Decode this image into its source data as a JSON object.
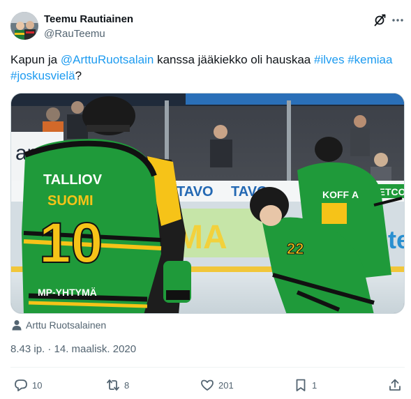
{
  "author": {
    "name": "Teemu Rautiainen",
    "handle": "@RauTeemu"
  },
  "tweet": {
    "text_parts": [
      {
        "text": "Kapun ja ",
        "type": "plain"
      },
      {
        "text": "@ArttuRuotsalain",
        "type": "link"
      },
      {
        "text": " kanssa jääkiekko oli hauskaa ",
        "type": "plain"
      },
      {
        "text": "#ilves",
        "type": "link"
      },
      {
        "text": " ",
        "type": "plain"
      },
      {
        "text": "#kemiaa",
        "type": "link"
      },
      {
        "text": " ",
        "type": "plain"
      },
      {
        "text": "#joskusvielä",
        "type": "link"
      },
      {
        "text": "?",
        "type": "plain"
      }
    ],
    "photo": {
      "left_jersey_name": "TALLIOV",
      "left_jersey_sub": "SUOMI",
      "left_jersey_number": "10",
      "left_jersey_sponsor": "MP-YHTYMÄ",
      "back_jersey_number": "10",
      "center_jersey_number": "22",
      "right_jersey_sponsor": "KOFF",
      "right_jersey_letter": "A",
      "rink_ad_1": "TAVO",
      "rink_ad_2": "TAVO",
      "rink_ad_3": "METCO",
      "rink_ad_4": "MA",
      "rink_ad_5": "ete"
    },
    "tagged_user": "Arttu Ruotsalainen",
    "timestamp": "8.43 ip. · 14. maalisk. 2020"
  },
  "actions": {
    "reply_count": "10",
    "repost_count": "8",
    "like_count": "201",
    "bookmark_count": "1"
  },
  "colors": {
    "link": "#1d9bf0",
    "secondary_text": "#536471",
    "jersey_green": "#1f9a3a",
    "jersey_yellow": "#f6c318"
  },
  "icons": [
    "grok-icon",
    "more-icon",
    "person-icon",
    "reply-icon",
    "repost-icon",
    "like-icon",
    "bookmark-icon",
    "share-icon"
  ]
}
